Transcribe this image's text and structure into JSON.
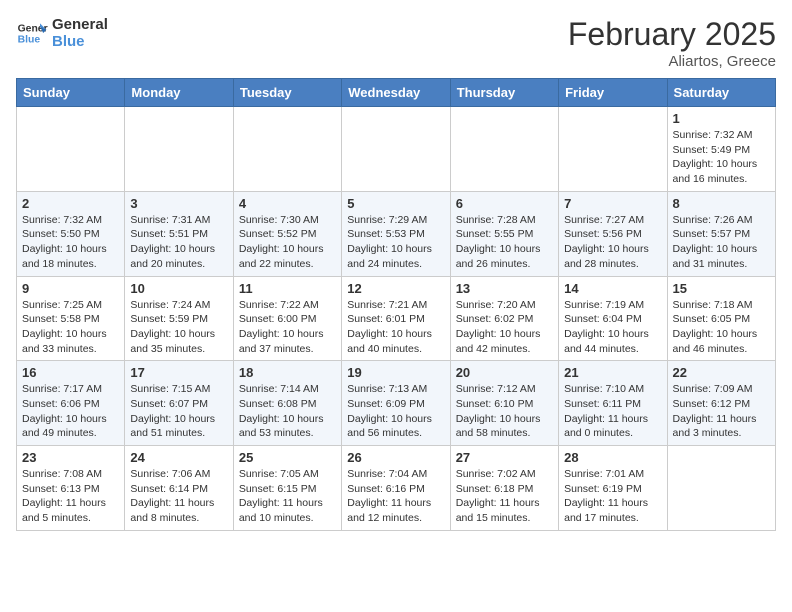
{
  "header": {
    "logo_line1": "General",
    "logo_line2": "Blue",
    "month": "February 2025",
    "location": "Aliartos, Greece"
  },
  "days_of_week": [
    "Sunday",
    "Monday",
    "Tuesday",
    "Wednesday",
    "Thursday",
    "Friday",
    "Saturday"
  ],
  "weeks": [
    [
      {
        "num": "",
        "info": ""
      },
      {
        "num": "",
        "info": ""
      },
      {
        "num": "",
        "info": ""
      },
      {
        "num": "",
        "info": ""
      },
      {
        "num": "",
        "info": ""
      },
      {
        "num": "",
        "info": ""
      },
      {
        "num": "1",
        "info": "Sunrise: 7:32 AM\nSunset: 5:49 PM\nDaylight: 10 hours and 16 minutes."
      }
    ],
    [
      {
        "num": "2",
        "info": "Sunrise: 7:32 AM\nSunset: 5:50 PM\nDaylight: 10 hours and 18 minutes."
      },
      {
        "num": "3",
        "info": "Sunrise: 7:31 AM\nSunset: 5:51 PM\nDaylight: 10 hours and 20 minutes."
      },
      {
        "num": "4",
        "info": "Sunrise: 7:30 AM\nSunset: 5:52 PM\nDaylight: 10 hours and 22 minutes."
      },
      {
        "num": "5",
        "info": "Sunrise: 7:29 AM\nSunset: 5:53 PM\nDaylight: 10 hours and 24 minutes."
      },
      {
        "num": "6",
        "info": "Sunrise: 7:28 AM\nSunset: 5:55 PM\nDaylight: 10 hours and 26 minutes."
      },
      {
        "num": "7",
        "info": "Sunrise: 7:27 AM\nSunset: 5:56 PM\nDaylight: 10 hours and 28 minutes."
      },
      {
        "num": "8",
        "info": "Sunrise: 7:26 AM\nSunset: 5:57 PM\nDaylight: 10 hours and 31 minutes."
      }
    ],
    [
      {
        "num": "9",
        "info": "Sunrise: 7:25 AM\nSunset: 5:58 PM\nDaylight: 10 hours and 33 minutes."
      },
      {
        "num": "10",
        "info": "Sunrise: 7:24 AM\nSunset: 5:59 PM\nDaylight: 10 hours and 35 minutes."
      },
      {
        "num": "11",
        "info": "Sunrise: 7:22 AM\nSunset: 6:00 PM\nDaylight: 10 hours and 37 minutes."
      },
      {
        "num": "12",
        "info": "Sunrise: 7:21 AM\nSunset: 6:01 PM\nDaylight: 10 hours and 40 minutes."
      },
      {
        "num": "13",
        "info": "Sunrise: 7:20 AM\nSunset: 6:02 PM\nDaylight: 10 hours and 42 minutes."
      },
      {
        "num": "14",
        "info": "Sunrise: 7:19 AM\nSunset: 6:04 PM\nDaylight: 10 hours and 44 minutes."
      },
      {
        "num": "15",
        "info": "Sunrise: 7:18 AM\nSunset: 6:05 PM\nDaylight: 10 hours and 46 minutes."
      }
    ],
    [
      {
        "num": "16",
        "info": "Sunrise: 7:17 AM\nSunset: 6:06 PM\nDaylight: 10 hours and 49 minutes."
      },
      {
        "num": "17",
        "info": "Sunrise: 7:15 AM\nSunset: 6:07 PM\nDaylight: 10 hours and 51 minutes."
      },
      {
        "num": "18",
        "info": "Sunrise: 7:14 AM\nSunset: 6:08 PM\nDaylight: 10 hours and 53 minutes."
      },
      {
        "num": "19",
        "info": "Sunrise: 7:13 AM\nSunset: 6:09 PM\nDaylight: 10 hours and 56 minutes."
      },
      {
        "num": "20",
        "info": "Sunrise: 7:12 AM\nSunset: 6:10 PM\nDaylight: 10 hours and 58 minutes."
      },
      {
        "num": "21",
        "info": "Sunrise: 7:10 AM\nSunset: 6:11 PM\nDaylight: 11 hours and 0 minutes."
      },
      {
        "num": "22",
        "info": "Sunrise: 7:09 AM\nSunset: 6:12 PM\nDaylight: 11 hours and 3 minutes."
      }
    ],
    [
      {
        "num": "23",
        "info": "Sunrise: 7:08 AM\nSunset: 6:13 PM\nDaylight: 11 hours and 5 minutes."
      },
      {
        "num": "24",
        "info": "Sunrise: 7:06 AM\nSunset: 6:14 PM\nDaylight: 11 hours and 8 minutes."
      },
      {
        "num": "25",
        "info": "Sunrise: 7:05 AM\nSunset: 6:15 PM\nDaylight: 11 hours and 10 minutes."
      },
      {
        "num": "26",
        "info": "Sunrise: 7:04 AM\nSunset: 6:16 PM\nDaylight: 11 hours and 12 minutes."
      },
      {
        "num": "27",
        "info": "Sunrise: 7:02 AM\nSunset: 6:18 PM\nDaylight: 11 hours and 15 minutes."
      },
      {
        "num": "28",
        "info": "Sunrise: 7:01 AM\nSunset: 6:19 PM\nDaylight: 11 hours and 17 minutes."
      },
      {
        "num": "",
        "info": ""
      }
    ]
  ]
}
